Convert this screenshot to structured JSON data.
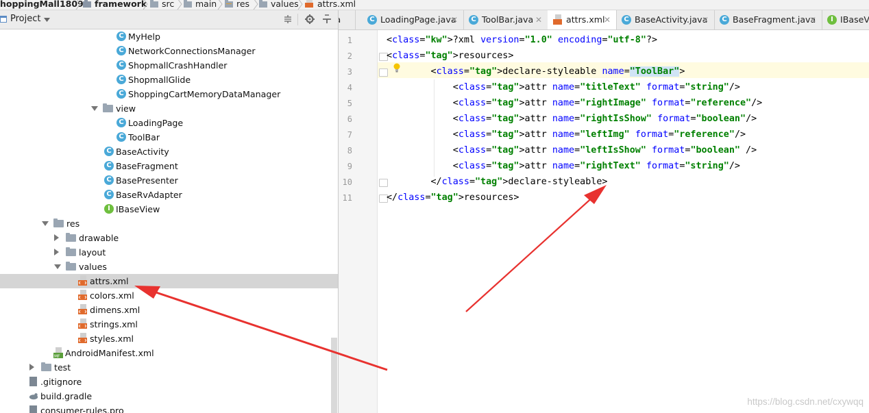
{
  "breadcrumb": [
    "hoppingMall1809",
    "framework",
    "src",
    "main",
    "res",
    "values",
    "attrs.xml"
  ],
  "project_panel": {
    "title": "Project",
    "tree": [
      {
        "label": "MyHelp",
        "type": "class"
      },
      {
        "label": "NetworkConnectionsManager",
        "type": "class"
      },
      {
        "label": "ShopmallCrashHandler",
        "type": "class"
      },
      {
        "label": "ShopmallGlide",
        "type": "class"
      },
      {
        "label": "ShoppingCartMemoryDataManager",
        "type": "class"
      },
      {
        "label": "view",
        "type": "folder",
        "expanded": true
      },
      {
        "label": "LoadingPage",
        "type": "class"
      },
      {
        "label": "ToolBar",
        "type": "class"
      },
      {
        "label": "BaseActivity",
        "type": "class"
      },
      {
        "label": "BaseFragment",
        "type": "class"
      },
      {
        "label": "BasePresenter",
        "type": "class"
      },
      {
        "label": "BaseRvAdapter",
        "type": "class"
      },
      {
        "label": "IBaseView",
        "type": "interface"
      },
      {
        "label": "res",
        "type": "folder",
        "expanded": true
      },
      {
        "label": "drawable",
        "type": "folder",
        "expanded": false
      },
      {
        "label": "layout",
        "type": "folder",
        "expanded": false
      },
      {
        "label": "values",
        "type": "folder",
        "expanded": true
      },
      {
        "label": "attrs.xml",
        "type": "xml",
        "selected": true
      },
      {
        "label": "colors.xml",
        "type": "xml"
      },
      {
        "label": "dimens.xml",
        "type": "xml"
      },
      {
        "label": "strings.xml",
        "type": "xml"
      },
      {
        "label": "styles.xml",
        "type": "xml"
      },
      {
        "label": "AndroidManifest.xml",
        "type": "manifest"
      },
      {
        "label": "test",
        "type": "folder",
        "expanded": false
      },
      {
        "label": ".gitignore",
        "type": "file"
      },
      {
        "label": "build.gradle",
        "type": "gradle"
      },
      {
        "label": "consumer-rules.pro",
        "type": "file"
      }
    ]
  },
  "tabs": [
    {
      "label": "va",
      "icon": "none"
    },
    {
      "label": "LoadingPage.java",
      "icon": "class"
    },
    {
      "label": "ToolBar.java",
      "icon": "class"
    },
    {
      "label": "attrs.xml",
      "icon": "xml",
      "active": true
    },
    {
      "label": "BaseActivity.java",
      "icon": "class"
    },
    {
      "label": "BaseFragment.java",
      "icon": "class"
    },
    {
      "label": "IBaseVi",
      "icon": "interface"
    }
  ],
  "editor": {
    "line_numbers": [
      "1",
      "2",
      "3",
      "4",
      "5",
      "6",
      "7",
      "8",
      "9",
      "10",
      "11"
    ],
    "lines": [
      "<?xml version=\"1.0\" encoding=\"utf-8\"?>",
      "<resources>",
      "        <declare-styleable name=\"ToolBar\">",
      "            <attr name=\"titleText\" format=\"string\"/>",
      "            <attr name=\"rightImage\" format=\"reference\"/>",
      "            <attr name=\"rightIsShow\" format=\"boolean\"/>",
      "            <attr name=\"leftImg\" format=\"reference\"/>",
      "            <attr name=\"leftIsShow\" format=\"boolean\" />",
      "            <attr name=\"rightText\" format=\"string\"/>",
      "        </declare-styleable>",
      "</resources>"
    ]
  },
  "watermark": "https://blog.csdn.net/cxywqq",
  "colors": {
    "annotation_arrow": "#e8322f",
    "selected_row": "#d5d5d5",
    "class_icon": "#4aa9d8",
    "interface_icon": "#6fbf3f",
    "xml_tag": "#000080",
    "xml_attr": "#0000ff",
    "xml_value": "#008000"
  }
}
